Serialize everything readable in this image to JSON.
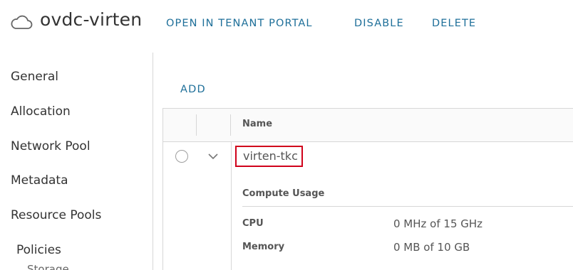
{
  "header": {
    "title": "ovdc-virten",
    "icon": "cloud-icon",
    "actions": [
      "OPEN IN TENANT PORTAL",
      "DISABLE",
      "DELETE"
    ]
  },
  "sidebar": {
    "items": [
      "General",
      "Allocation",
      "Network Pool",
      "Metadata",
      "Resource Pools",
      "Policies",
      "Storage"
    ]
  },
  "main": {
    "add_label": "ADD",
    "grid": {
      "columns": [
        "Name"
      ],
      "rows": [
        {
          "name": "virten-tkc",
          "detail": {
            "section_title": "Compute Usage",
            "items": [
              {
                "label": "CPU",
                "value": "0 MHz of 15 GHz"
              },
              {
                "label": "Memory",
                "value": "0 MB of 10 GB"
              }
            ]
          }
        }
      ]
    }
  },
  "colors": {
    "accent": "#1e6f99",
    "highlight": "#d0021b",
    "border": "#d7d7d7"
  }
}
